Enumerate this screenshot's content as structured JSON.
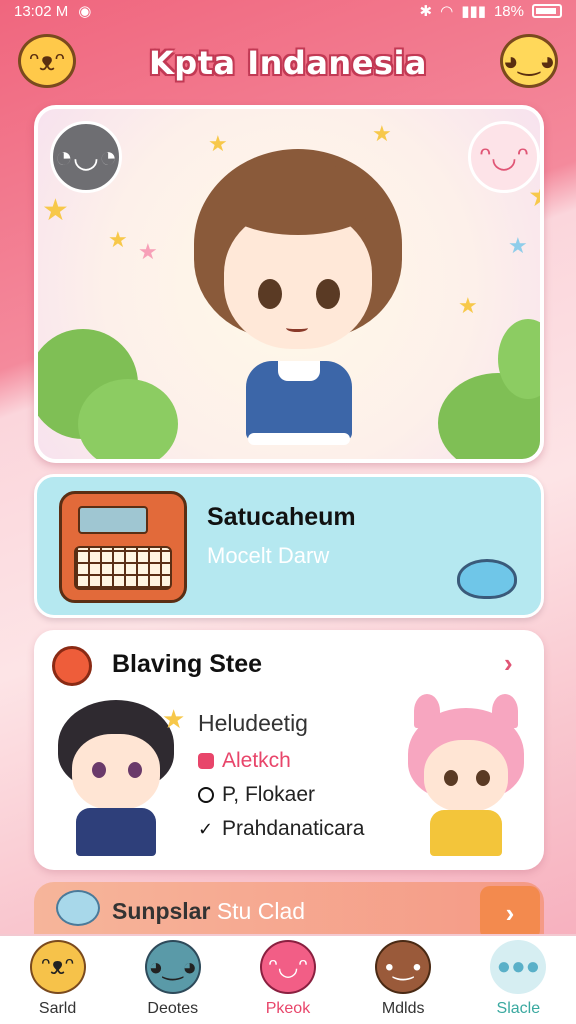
{
  "status_bar": {
    "time": "13:02 M",
    "battery": "18%"
  },
  "header": {
    "title": "Kpta Indanesia",
    "left_mascot_icon": "bear-mascot-icon",
    "right_mascot_icon": "chick-mascot-icon"
  },
  "hero": {
    "left_bubble_icon": "gray-bird-icon",
    "right_bubble_icon": "smiley-face-icon",
    "illustration": "chibi-boy-illustration"
  },
  "card_blue": {
    "title": "Satucaheum",
    "subtitle": "Mocelt Darw",
    "icon": "typewriter-icon",
    "corner_icon": "whale-icon"
  },
  "card_white": {
    "title": "Blaving Stee",
    "list_title": "Heludeetig",
    "items": [
      {
        "label": "Aletkch",
        "marker": "square"
      },
      {
        "label": "P, Flokaer",
        "marker": "circle"
      },
      {
        "label": "Prahdanaticara",
        "marker": "check"
      }
    ]
  },
  "card_orange": {
    "title_bold": "Sunpslar",
    "title_light": "Stu Clad"
  },
  "nav": {
    "items": [
      {
        "label": "Sarld"
      },
      {
        "label": "Deotes"
      },
      {
        "label": "Pkeok"
      },
      {
        "label": "Mdlds"
      },
      {
        "label": "Slacle"
      }
    ]
  },
  "colors": {
    "accent": "#e8456a",
    "teal": "#3aa9a0",
    "header_pink": "#f0667e"
  }
}
